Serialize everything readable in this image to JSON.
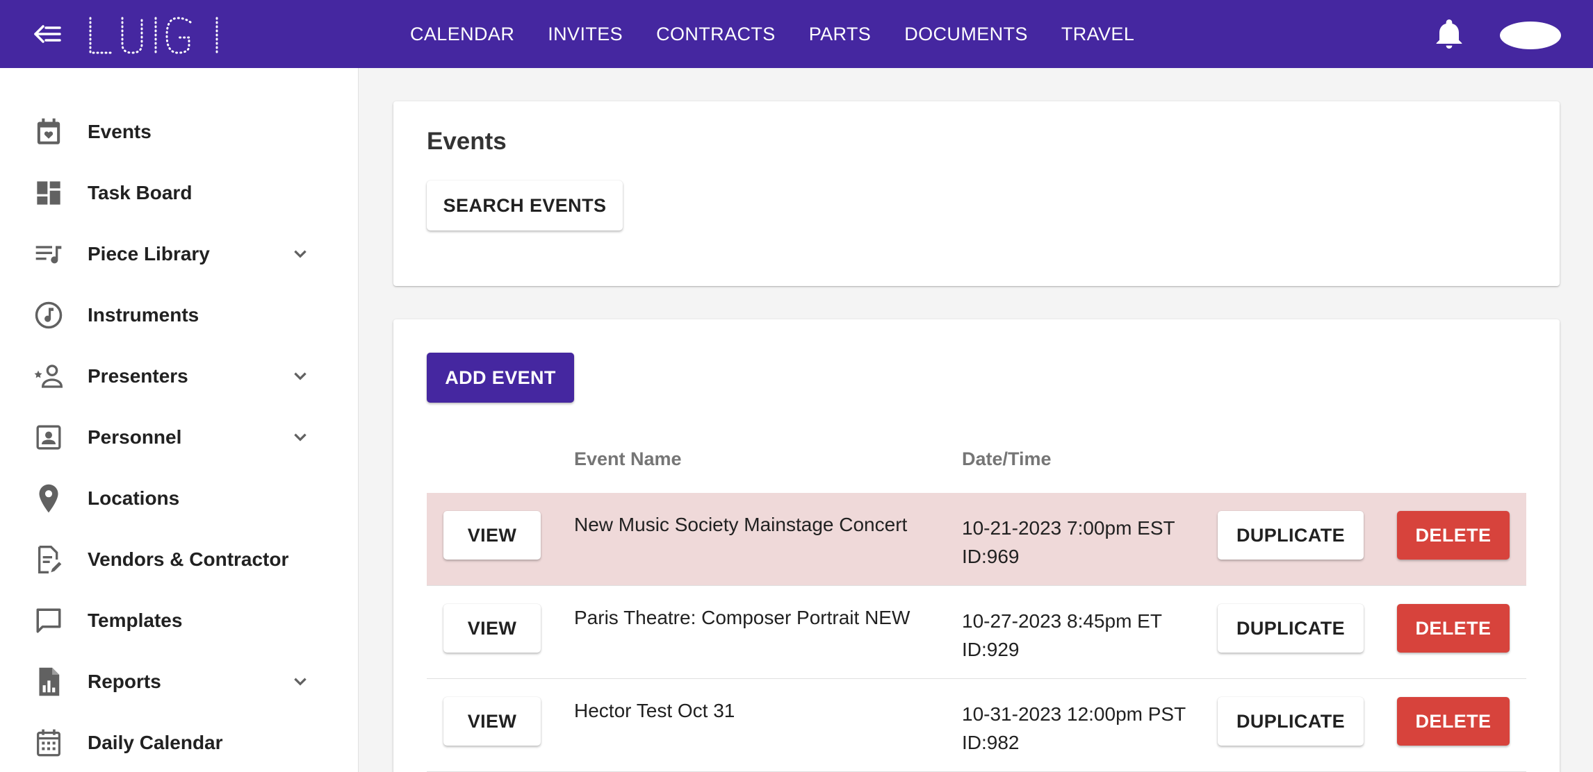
{
  "app": {
    "logo_text": "LUIGI"
  },
  "nav": {
    "items": [
      "CALENDAR",
      "INVITES",
      "CONTRACTS",
      "PARTS",
      "DOCUMENTS",
      "TRAVEL"
    ]
  },
  "sidebar": {
    "items": [
      {
        "label": "Events",
        "icon": "calendar-heart-icon",
        "expandable": false
      },
      {
        "label": "Task Board",
        "icon": "dashboard-icon",
        "expandable": false
      },
      {
        "label": "Piece Library",
        "icon": "music-list-icon",
        "expandable": true
      },
      {
        "label": "Instruments",
        "icon": "music-note-circle-icon",
        "expandable": false
      },
      {
        "label": "Presenters",
        "icon": "person-star-icon",
        "expandable": true
      },
      {
        "label": "Personnel",
        "icon": "contact-card-icon",
        "expandable": true
      },
      {
        "label": "Locations",
        "icon": "map-pin-icon",
        "expandable": false
      },
      {
        "label": "Vendors & Contractor",
        "icon": "document-edit-icon",
        "expandable": false
      },
      {
        "label": "Templates",
        "icon": "chat-bubble-icon",
        "expandable": false
      },
      {
        "label": "Reports",
        "icon": "report-chart-icon",
        "expandable": true
      },
      {
        "label": "Daily Calendar",
        "icon": "calendar-grid-icon",
        "expandable": false
      }
    ]
  },
  "search_card": {
    "title": "Events",
    "search_button": "SEARCH EVENTS"
  },
  "events": {
    "add_button": "ADD EVENT",
    "columns": {
      "name": "Event Name",
      "date": "Date/Time"
    },
    "view_label": "VIEW",
    "duplicate_label": "DUPLICATE",
    "delete_label": "DELETE",
    "rows": [
      {
        "name": "New Music Society Mainstage Concert",
        "datetime": "10-21-2023 7:00pm EST",
        "id": "ID:969",
        "highlighted": true
      },
      {
        "name": "Paris Theatre: Composer Portrait NEW",
        "datetime": "10-27-2023 8:45pm ET",
        "id": "ID:929",
        "highlighted": false
      },
      {
        "name": "Hector Test Oct 31",
        "datetime": "10-31-2023 12:00pm PST",
        "id": "ID:982",
        "highlighted": false
      }
    ]
  },
  "colors": {
    "primary": "#4527a0",
    "danger": "#d7433c",
    "highlight_row": "#efd9d9",
    "background": "#f4f4f4"
  }
}
